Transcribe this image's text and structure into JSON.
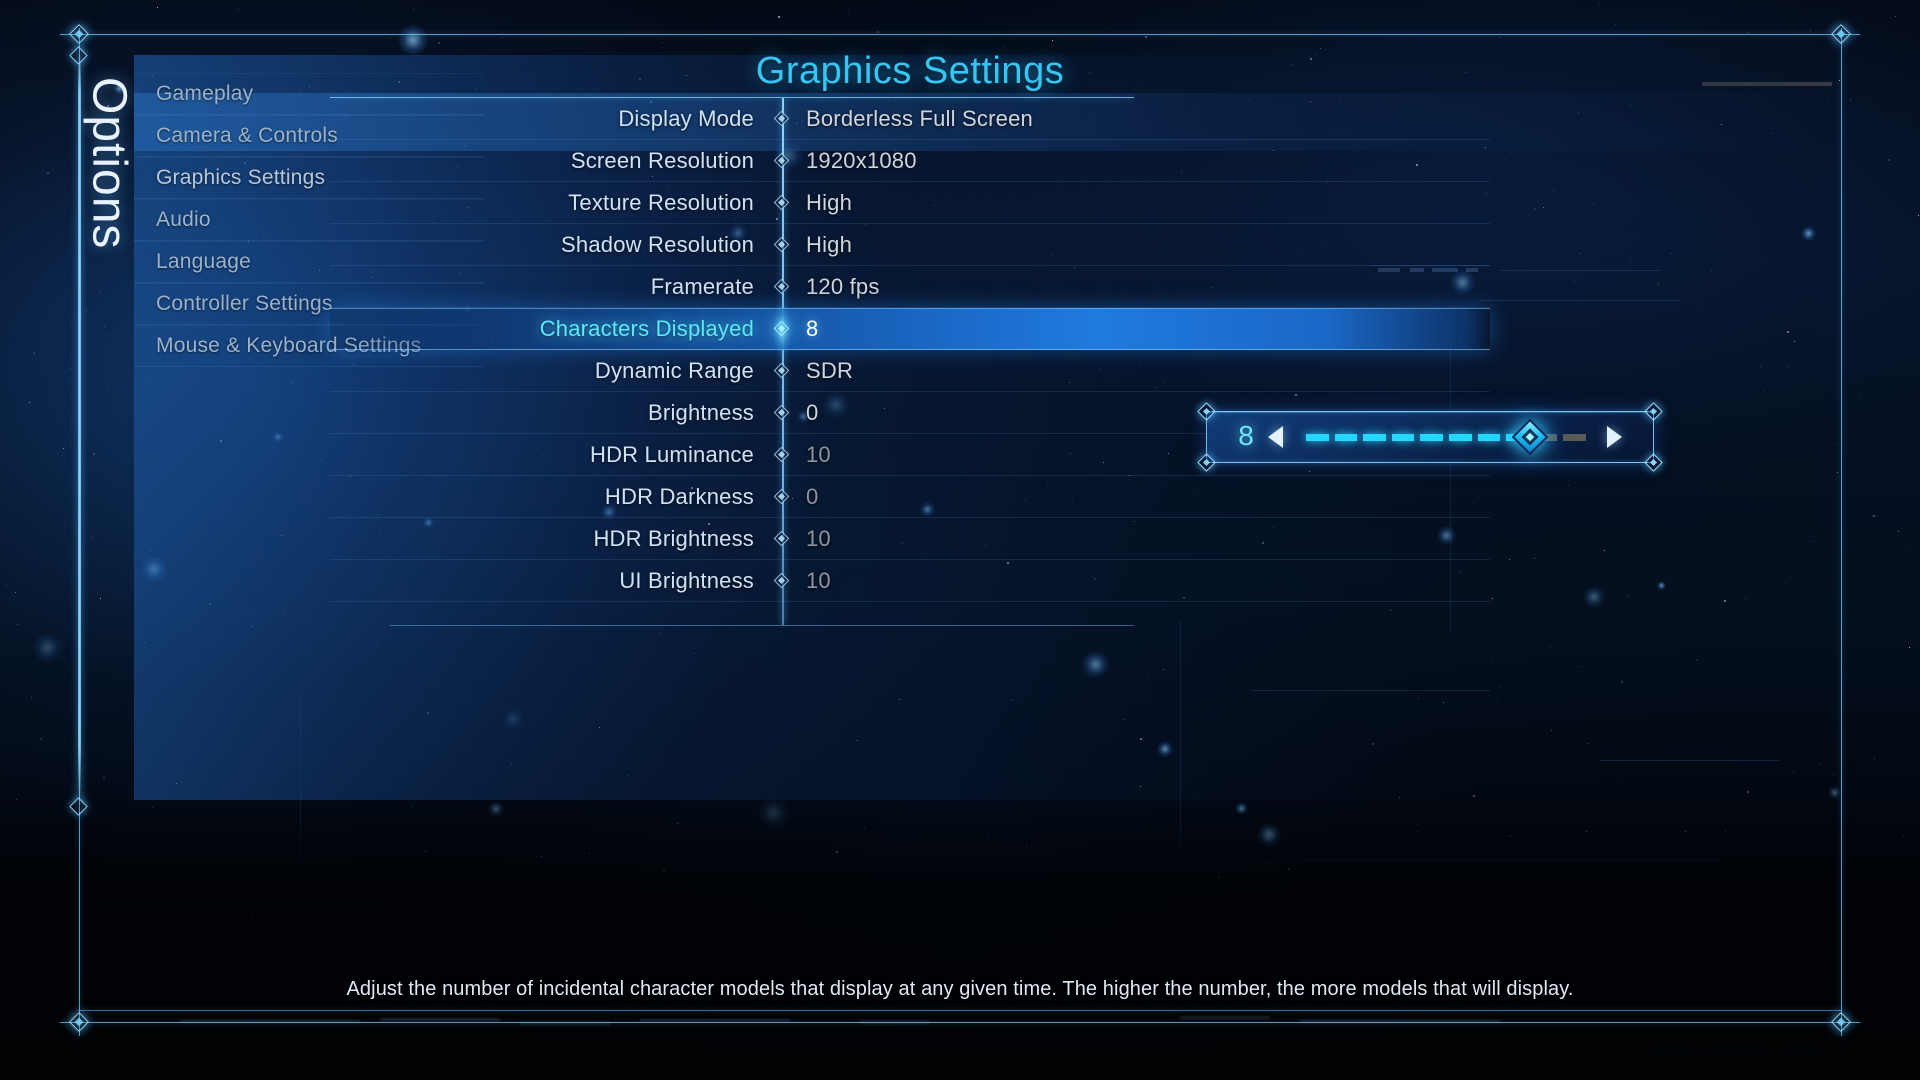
{
  "theme": {
    "accent_cyan": "#35c6f5",
    "accent_bright": "#5ce8ff",
    "highlight_blue": "#207ae0",
    "value_text": "#cfd6dd",
    "label_text": "#cfe3f7",
    "sidebar_text": "#9bb2c9"
  },
  "panel": {
    "vertical_label": "Options",
    "title": "Graphics Settings"
  },
  "sidebar": {
    "items": [
      {
        "label": "Gameplay",
        "active": false
      },
      {
        "label": "Camera & Controls",
        "active": false
      },
      {
        "label": "Graphics Settings",
        "active": true
      },
      {
        "label": "Audio",
        "active": false
      },
      {
        "label": "Language",
        "active": false
      },
      {
        "label": "Controller Settings",
        "active": false
      },
      {
        "label": "Mouse & Keyboard Settings",
        "active": false
      }
    ]
  },
  "settings": {
    "rows": [
      {
        "label": "Display Mode",
        "value": "Borderless Full Screen",
        "selected": false,
        "dim": false
      },
      {
        "label": "Screen Resolution",
        "value": "1920x1080",
        "selected": false,
        "dim": false
      },
      {
        "label": "Texture Resolution",
        "value": "High",
        "selected": false,
        "dim": false
      },
      {
        "label": "Shadow Resolution",
        "value": "High",
        "selected": false,
        "dim": false
      },
      {
        "label": "Framerate",
        "value": "120 fps",
        "selected": false,
        "dim": false
      },
      {
        "label": "Characters Displayed",
        "value": "8",
        "selected": true,
        "dim": false
      },
      {
        "label": "Dynamic Range",
        "value": "SDR",
        "selected": false,
        "dim": false
      },
      {
        "label": "Brightness",
        "value": "0",
        "selected": false,
        "dim": false
      },
      {
        "label": "HDR Luminance",
        "value": "10",
        "selected": false,
        "dim": true
      },
      {
        "label": "HDR Darkness",
        "value": "0",
        "selected": false,
        "dim": true
      },
      {
        "label": "HDR Brightness",
        "value": "10",
        "selected": false,
        "dim": true
      },
      {
        "label": "UI Brightness",
        "value": "10",
        "selected": false,
        "dim": true
      }
    ]
  },
  "slider_popup": {
    "value": "8",
    "min": 1,
    "max": 10,
    "current": 8,
    "segments_total": 10,
    "segments_filled": 8,
    "left_arrow": "◀",
    "right_arrow": "▶"
  },
  "footer": {
    "description": "Adjust the number of incidental character models that display at any given time. The higher the number, the more models that will display."
  }
}
